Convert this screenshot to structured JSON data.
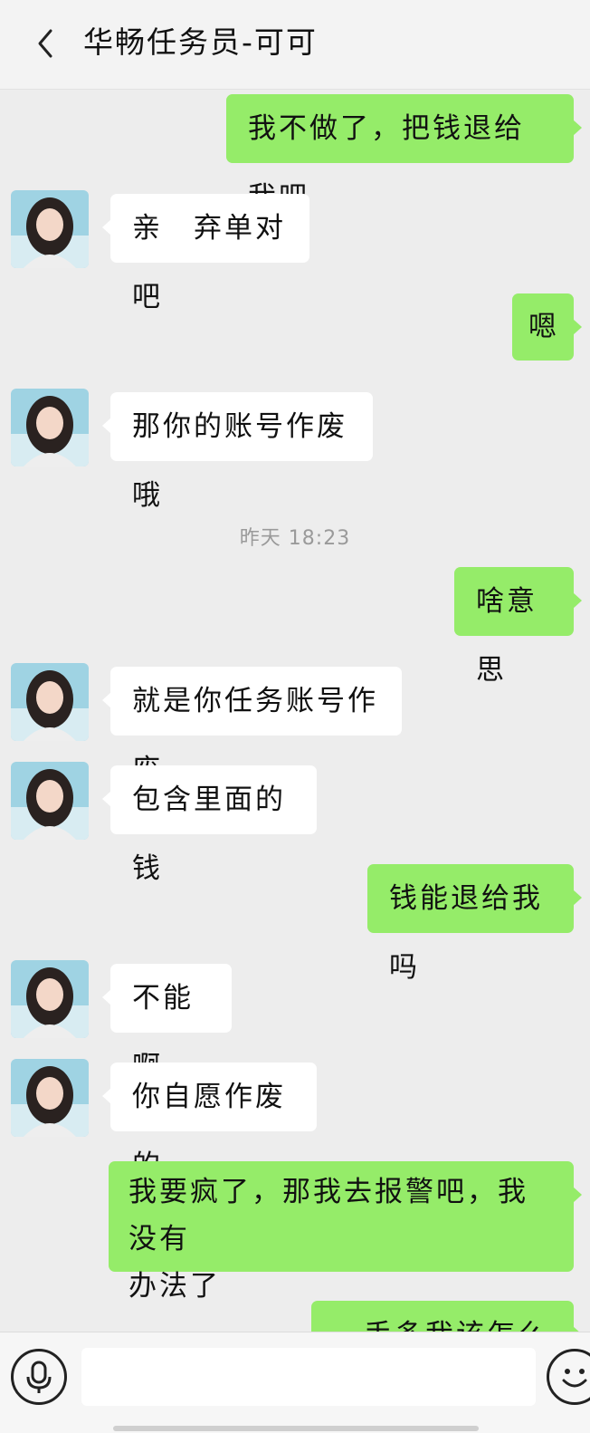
{
  "header": {
    "title": "华畅任务员-可可",
    "back_icon": "chevron-left-icon"
  },
  "chat": {
    "timestamp": "昨天 18:23",
    "messages": [
      {
        "side": "out",
        "text": "我不做了，把钱退给我吧"
      },
      {
        "side": "in",
        "text": "亲　弃单对吧"
      },
      {
        "side": "out",
        "text": "嗯"
      },
      {
        "side": "in",
        "text": "那你的账号作废哦"
      },
      {
        "side": "out",
        "text": "啥意思"
      },
      {
        "side": "in",
        "text": "就是你任务账号作废"
      },
      {
        "side": "in",
        "text": "包含里面的钱"
      },
      {
        "side": "out",
        "text": "钱能退给我吗"
      },
      {
        "side": "in",
        "text": "不能啊"
      },
      {
        "side": "in",
        "text": "你自愿作废的"
      },
      {
        "side": "out",
        "text": "我要疯了，那我去报警吧，我没有办法了",
        "line1": "我要疯了，那我去报警吧，我没有",
        "line2": "办法了"
      },
      {
        "side": "out",
        "text": "…手多我该怎么办"
      }
    ]
  },
  "input_bar": {
    "voice_icon": "microphone-icon",
    "emoji_icon": "smiley-icon",
    "input_value": ""
  }
}
